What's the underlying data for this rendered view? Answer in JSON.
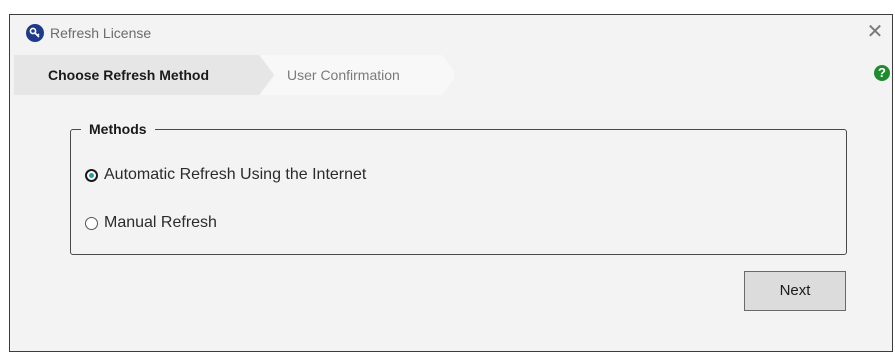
{
  "window": {
    "title": "Refresh License",
    "close_glyph": "✕"
  },
  "wizard": {
    "steps": [
      {
        "label": "Choose Refresh Method",
        "active": true
      },
      {
        "label": "User Confirmation",
        "active": false
      }
    ],
    "help_glyph": "?"
  },
  "methods": {
    "legend": "Methods",
    "options": [
      {
        "label": "Automatic Refresh Using the Internet",
        "selected": true
      },
      {
        "label": "Manual Refresh",
        "selected": false
      }
    ]
  },
  "buttons": {
    "next_label": "Next"
  },
  "icons": {
    "app": "key-icon",
    "help": "help-icon",
    "close": "close-icon"
  },
  "colors": {
    "app_icon": "#1e3a8a",
    "help_icon": "#1f8b2e",
    "radio_dot": "#1fa1a1",
    "active_step_bg": "#e9e9e9",
    "inactive_step_bg": "#f7f7f7"
  }
}
